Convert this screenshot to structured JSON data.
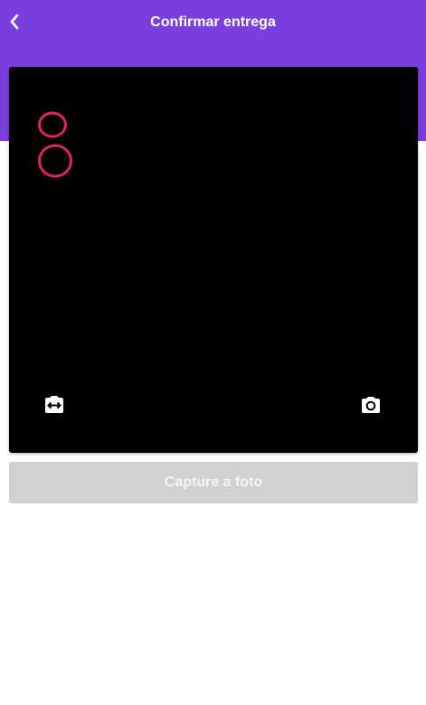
{
  "header": {
    "title": "Confirmar entrega",
    "back_icon": "chevron-left-icon",
    "background_color": "#7b3fe0"
  },
  "camera": {
    "switch_icon": "switch-camera-icon",
    "shutter_icon": "camera-icon",
    "doodle_color": "#e0245e"
  },
  "capture": {
    "label": "Capture a foto",
    "disabled": true
  }
}
